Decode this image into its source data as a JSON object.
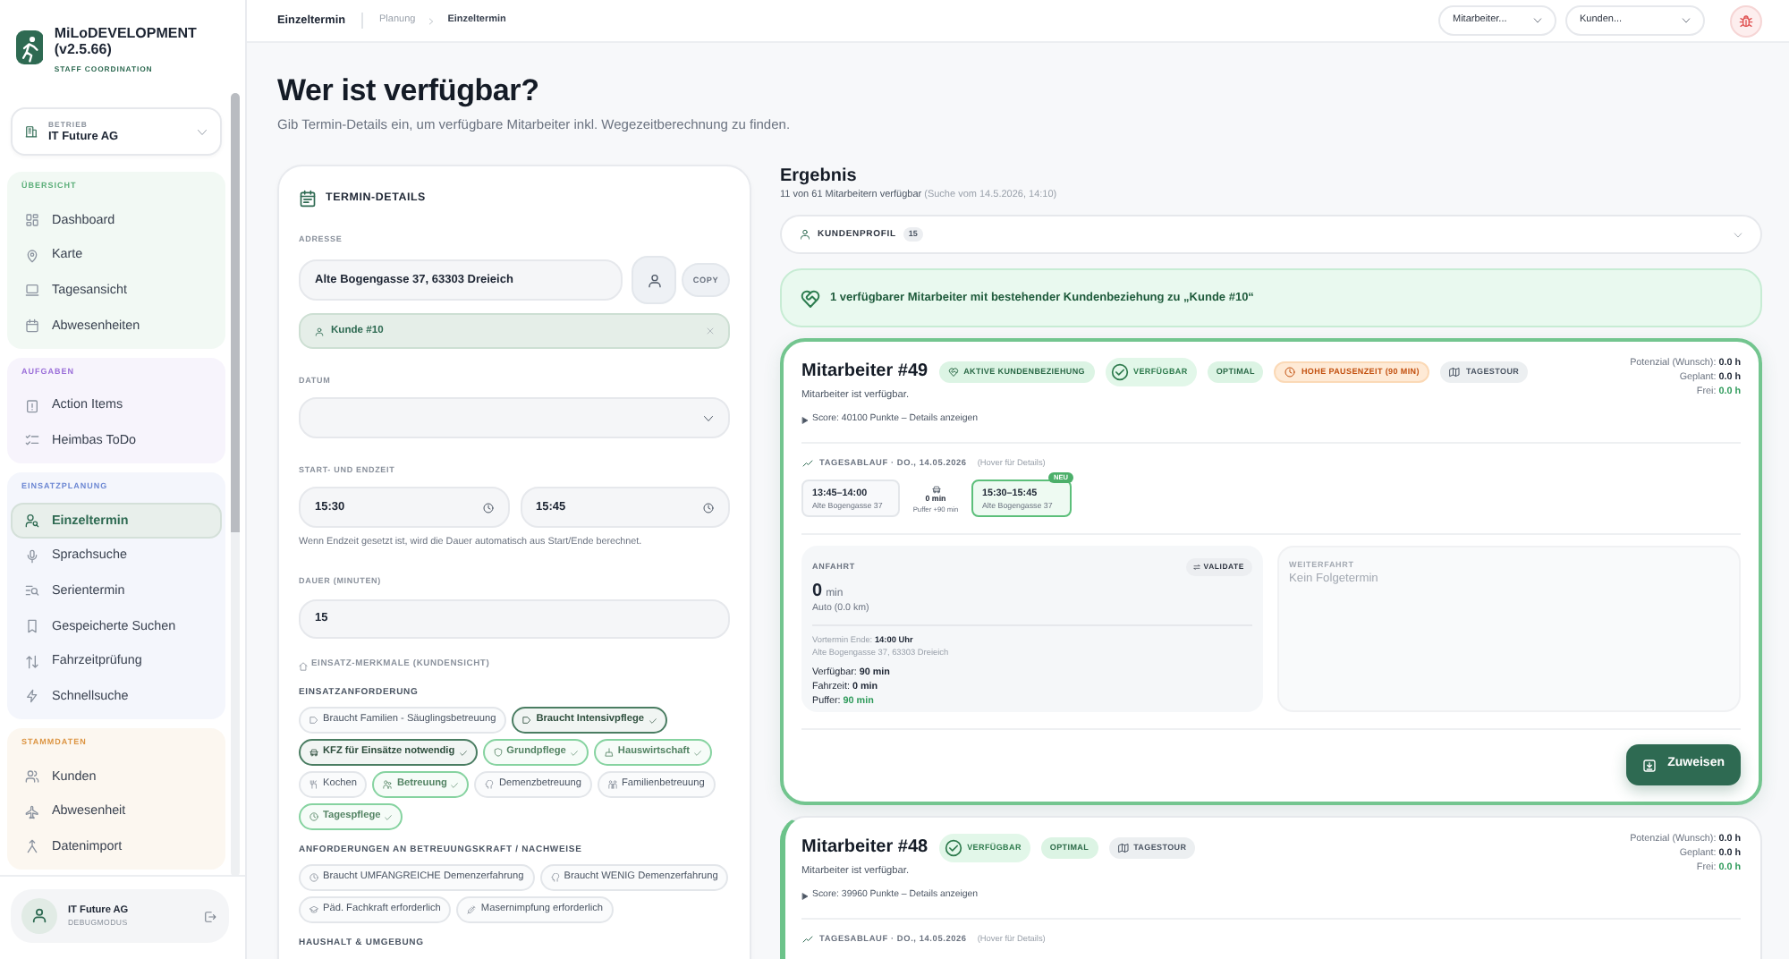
{
  "topbar": {
    "title": "Einzeltermin",
    "breadcrumb": [
      {
        "label": "Planung"
      },
      {
        "label": "Einzeltermin"
      }
    ],
    "filters": [
      {
        "placeholder": "Mitarbeiter..."
      },
      {
        "placeholder": "Kunden..."
      }
    ]
  },
  "sidebar": {
    "app_title": "MiLoDEVELOPMENT (v2.5.66)",
    "app_subtitle": "STAFF COORDINATION",
    "company": {
      "label": "BETRIEB",
      "value": "IT Future AG"
    },
    "sections": [
      {
        "title": "ÜBERSICHT",
        "color": "#5aae78",
        "items": [
          {
            "label": "Dashboard",
            "selected": false
          },
          {
            "label": "Karte",
            "selected": false
          },
          {
            "label": "Tagesansicht",
            "selected": false
          },
          {
            "label": "Abwesenheiten",
            "selected": false
          }
        ]
      },
      {
        "title": "AUFGABEN",
        "color": "#9b6fd9",
        "items": [
          {
            "label": "Action Items",
            "selected": false
          },
          {
            "label": "Heimbas ToDo",
            "selected": false
          }
        ]
      },
      {
        "title": "EINSATZPLANUNG",
        "color": "#6d88d3",
        "items": [
          {
            "label": "Einzeltermin",
            "selected": true
          },
          {
            "label": "Sprachsuche",
            "selected": false
          },
          {
            "label": "Serientermin",
            "selected": false
          },
          {
            "label": "Gespeicherte Suchen",
            "selected": false
          },
          {
            "label": "Fahrzeitprüfung",
            "selected": false
          },
          {
            "label": "Schnellsuche",
            "selected": false
          }
        ]
      },
      {
        "title": "STAMMDATEN",
        "color": "#dc9543",
        "items": [
          {
            "label": "Kunden",
            "selected": false
          },
          {
            "label": "Abwesenheit",
            "selected": false
          },
          {
            "label": "Datenimport",
            "selected": false
          }
        ]
      }
    ],
    "user": {
      "name": "IT Future AG",
      "role": "DEBUGMODUS"
    }
  },
  "page": {
    "heading": "Wer ist verfügbar?",
    "subtitle": "Gib Termin-Details ein, um verfügbare Mitarbeiter inkl. Wegezeitberechnung zu finden."
  },
  "form": {
    "title": "TERMIN-DETAILS",
    "address": {
      "label": "ADRESSE",
      "value": "Alte Bogengasse 37, 63303 Dreieich",
      "copy_button": "COPY"
    },
    "customer": {
      "label": "Kunde #10"
    },
    "date": {
      "label": "DATUM"
    },
    "time": {
      "label": "START- UND ENDZEIT",
      "start": "15:30",
      "end": "15:45",
      "hint": "Wenn Endzeit gesetzt ist, wird die Dauer automatisch aus Start/Ende berechnet."
    },
    "duration": {
      "label": "DAUER (MINUTEN)",
      "value": "15"
    },
    "features": {
      "title": "EINSATZ-MERKMALE (KUNDENSICHT)",
      "groups": [
        {
          "title": "EINSATZANFORDERUNG",
          "chips": [
            {
              "label": "Braucht Familien - Säuglingsbetreuung",
              "selected": false
            },
            {
              "label": "Braucht Intensivpflege",
              "selected": true,
              "color": "#4a7d62"
            },
            {
              "label": "KFZ für Einsätze notwendig",
              "selected": true,
              "color": "#4a7d62"
            },
            {
              "label": "Grundpflege",
              "selected": true,
              "color": "#86d3a0"
            },
            {
              "label": "Hauswirtschaft",
              "selected": true,
              "color": "#86d3a0"
            },
            {
              "label": "Kochen",
              "selected": false
            },
            {
              "label": "Betreuung",
              "selected": true,
              "color": "#86d3a0"
            },
            {
              "label": "Demenzbetreuung",
              "selected": false
            },
            {
              "label": "Familienbetreuung",
              "selected": false
            },
            {
              "label": "Tagespflege",
              "selected": true,
              "color": "#86d3a0"
            }
          ]
        },
        {
          "title": "ANFORDERUNGEN AN BETREUUNGSKRAFT / NACHWEISE",
          "chips": [
            {
              "label": "Braucht UMFANGREICHE Demenzerfahrung",
              "selected": false
            },
            {
              "label": "Braucht WENIG Demenzerfahrung",
              "selected": false
            },
            {
              "label": "Päd. Fachkraft erforderlich",
              "selected": false
            },
            {
              "label": "Masernimpfung erforderlich",
              "selected": false
            }
          ]
        },
        {
          "title": "HAUSHALT & UMGEBUNG"
        }
      ]
    }
  },
  "result": {
    "title": "Ergebnis",
    "summary": "11 von 61 Mitarbeitern verfügbar",
    "search_info": "(Suche vom 14.5.2026, 14:10)",
    "customer_profile": {
      "label": "KUNDENPROFIL",
      "count": "15",
      "expanded": false
    },
    "alert": "1 verfügbarer Mitarbeiter mit bestehender Kundenbeziehung zu „Kunde #10“",
    "employees": [
      {
        "name": "Mitarbeiter #49",
        "highlighted": true,
        "badges": [
          {
            "label": "AKTIVE KUNDENBEZIEHUNG",
            "kind": "relation"
          },
          {
            "label": "VERFÜGBAR",
            "kind": "available"
          },
          {
            "label": "OPTIMAL",
            "kind": "optimal"
          },
          {
            "label": "HOHE PAUSENZEIT (90 MIN)",
            "kind": "warning"
          },
          {
            "label": "TAGESTOUR",
            "kind": "tour"
          }
        ],
        "status": "Mitarbeiter ist verfügbar.",
        "score": "Score: 40100 Punkte – Details anzeigen",
        "details_expanded": false,
        "stats": [
          {
            "label": "Potenzial (Wunsch):",
            "value": "0.0 h",
            "highlight": false
          },
          {
            "label": "Geplant:",
            "value": "0.0 h",
            "highlight": false
          },
          {
            "label": "Frei:",
            "value": "0.0 h",
            "highlight": true
          }
        ],
        "timeline": {
          "title": "TAGESABLAUF · DO., 14.05.2026",
          "hint": "(Hover für Details)",
          "items": [
            {
              "kind": "appointment",
              "time": "13:45–14:00",
              "place": "Alte Bogengasse 37"
            },
            {
              "kind": "travel",
              "duration": "0 min",
              "buffer": "Puffer +90 min"
            },
            {
              "kind": "new",
              "time": "15:30–15:45",
              "place": "Alte Bogengasse 37",
              "badge": "NEU"
            }
          ]
        },
        "arrival": {
          "title": "ANFAHRT",
          "validate_button": "VALIDATE",
          "value": "0",
          "unit": "min",
          "mode": "Auto (0.0 km)",
          "previous": {
            "label": "Vortermin Ende:",
            "value": "14:00 Uhr"
          },
          "address": "Alte Bogengasse 37, 63303 Dreieich",
          "stats": [
            {
              "label": "Verfügbar:",
              "value": "90 min",
              "highlight": false
            },
            {
              "label": "Fahrzeit:",
              "value": "0 min",
              "highlight": false
            },
            {
              "label": "Puffer:",
              "value": "90 min",
              "highlight": true
            }
          ]
        },
        "onward": {
          "title": "WEITERFAHRT",
          "text": "Kein Folgetermin"
        },
        "assign_button": "Zuweisen"
      },
      {
        "name": "Mitarbeiter #48",
        "highlighted": false,
        "badges": [
          {
            "label": "VERFÜGBAR",
            "kind": "available"
          },
          {
            "label": "OPTIMAL",
            "kind": "optimal"
          },
          {
            "label": "TAGESTOUR",
            "kind": "tour"
          }
        ],
        "status": "Mitarbeiter ist verfügbar.",
        "score": "Score: 39960 Punkte – Details anzeigen",
        "details_expanded": false,
        "stats": [
          {
            "label": "Potenzial (Wunsch):",
            "value": "0.0 h",
            "highlight": false
          },
          {
            "label": "Geplant:",
            "value": "0.0 h",
            "highlight": false
          },
          {
            "label": "Frei:",
            "value": "0.0 h",
            "highlight": true
          }
        ],
        "timeline": {
          "title": "TAGESABLAUF · DO., 14.05.2026",
          "hint": "(Hover für Details)"
        }
      }
    ]
  }
}
